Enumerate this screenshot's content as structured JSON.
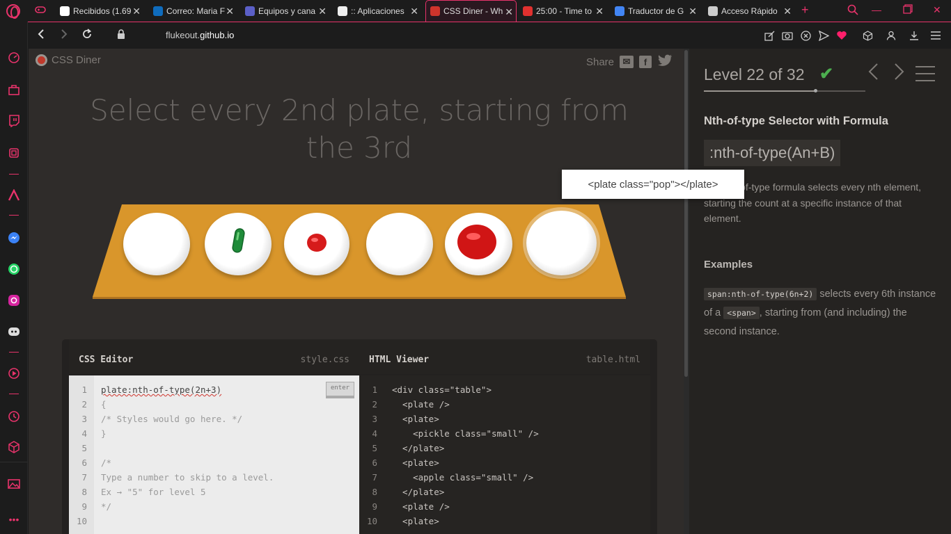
{
  "browser": {
    "tabs": [
      {
        "title": "Recibidos (1.69",
        "favicon": "gmail-icon",
        "color": "#ffffff"
      },
      {
        "title": "Correo: Maria F",
        "favicon": "outlook-icon",
        "color": "#0f6cbd"
      },
      {
        "title": "Equipos y cana",
        "favicon": "teams-icon",
        "color": "#5b5fc7"
      },
      {
        "title": ":: Aplicaciones",
        "favicon": "globe-icon",
        "color": "#eeeeee"
      },
      {
        "title": "CSS Diner - Wh",
        "favicon": "css-diner-icon",
        "color": "#d0342c",
        "active": true
      },
      {
        "title": "25:00 - Time to",
        "favicon": "timer-icon",
        "color": "#e0312f"
      },
      {
        "title": "Traductor de G",
        "favicon": "google-translate-icon",
        "color": "#4285f4"
      },
      {
        "title": "Acceso Rápido",
        "favicon": "speed-dial-icon",
        "color": "#cccccc"
      }
    ],
    "url_prefix": "flukeout.",
    "url_domain": "github.io",
    "accent": "#e8336b"
  },
  "game": {
    "logo": "CSS Diner",
    "share": "Share",
    "order_text": "Select every 2nd plate, starting from the 3rd",
    "tooltip": "<plate class=\"pop\"></plate>"
  },
  "editor": {
    "css_title": "CSS Editor",
    "css_file": "style.css",
    "html_title": "HTML Viewer",
    "html_file": "table.html",
    "enter_label": "enter",
    "css_input": "plate:nth-of-type(2n+3)",
    "css_lines": [
      "{",
      "/* Styles would go here. */",
      "}",
      "",
      "/*",
      "Type a number to skip to a level.",
      "Ex → \"5\" for level 5",
      "*/",
      ""
    ],
    "line_numbers": [
      "1",
      "2",
      "3",
      "4",
      "5",
      "6",
      "7",
      "8",
      "9",
      "10"
    ],
    "html_lines": [
      "<div class=\"table\">",
      "  <plate />",
      "  <plate>",
      "    <pickle class=\"small\" />",
      "  </plate>",
      "  <plate>",
      "    <apple class=\"small\" />",
      "  </plate>",
      "  <plate />",
      "  <plate>"
    ]
  },
  "level": {
    "title": "Level 22 of 32",
    "completed": true,
    "progress": 0.6875,
    "selector_name": "Nth-of-type Selector with Formula",
    "syntax": ":nth-of-type(An+B)",
    "hint": "The nth-of-type formula selects every nth element, starting the count at a specific instance of that element.",
    "examples_title": "Examples",
    "example_code": "span:nth-of-type(6n+2)",
    "example_text_1": "selects every 6th instance of a",
    "example_code_2": "<span>",
    "example_text_2": ", starting from (and including) the second instance."
  }
}
